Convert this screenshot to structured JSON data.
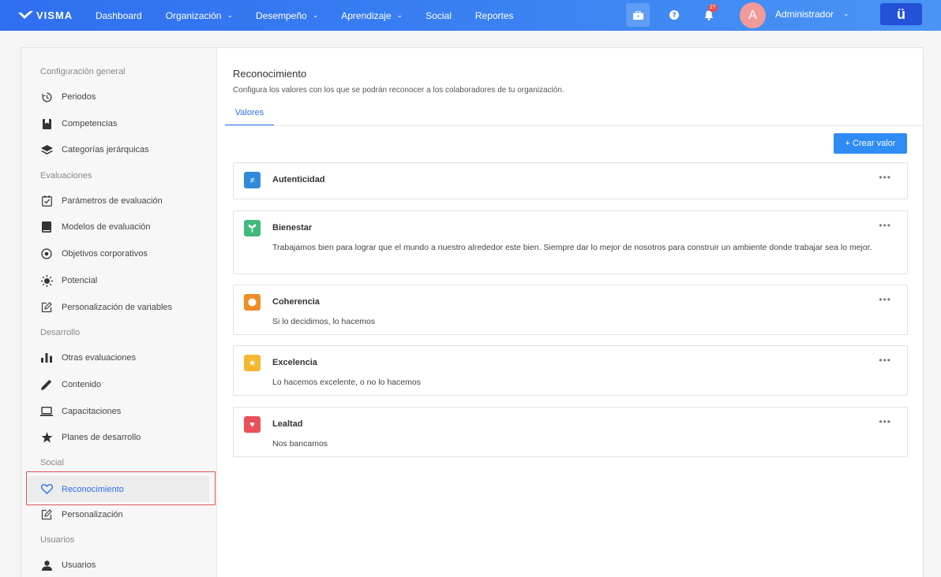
{
  "topbar": {
    "logo": "VISMA",
    "nav": [
      {
        "label": "Dashboard",
        "has_dropdown": false
      },
      {
        "label": "Organización",
        "has_dropdown": true
      },
      {
        "label": "Desempeño",
        "has_dropdown": true
      },
      {
        "label": "Aprendizaje",
        "has_dropdown": true
      },
      {
        "label": "Social",
        "has_dropdown": false
      },
      {
        "label": "Reportes",
        "has_dropdown": false
      }
    ],
    "notification_count": "27",
    "avatar_initial": "A",
    "user_name": "Administrador",
    "app_button": "ü"
  },
  "sidebar": {
    "sections": [
      {
        "title": "Configuración general",
        "items": [
          {
            "label": "Periodos",
            "icon": "history-icon"
          },
          {
            "label": "Competencias",
            "icon": "bookmark-icon"
          },
          {
            "label": "Categorías jerárquicas",
            "icon": "layers-icon"
          }
        ]
      },
      {
        "title": "Evaluaciones",
        "items": [
          {
            "label": "Parámetros de evaluación",
            "icon": "checkbox-icon"
          },
          {
            "label": "Modelos de evaluación",
            "icon": "book-icon"
          },
          {
            "label": "Objetivos corporativos",
            "icon": "target-icon"
          },
          {
            "label": "Potencial",
            "icon": "sun-icon"
          },
          {
            "label": "Personalización de variables",
            "icon": "edit-icon"
          }
        ]
      },
      {
        "title": "Desarrollo",
        "items": [
          {
            "label": "Otras evaluaciones",
            "icon": "bar-chart-icon"
          },
          {
            "label": "Contenido",
            "icon": "pencil-icon"
          },
          {
            "label": "Capacitaciones",
            "icon": "laptop-icon"
          },
          {
            "label": "Planes de desarrollo",
            "icon": "star-icon"
          }
        ]
      },
      {
        "title": "Social",
        "items": [
          {
            "label": "Reconocimiento",
            "icon": "heart-icon",
            "active": true
          },
          {
            "label": "Personalización",
            "icon": "edit-icon"
          }
        ]
      },
      {
        "title": "Usuarios",
        "items": [
          {
            "label": "Usuarios",
            "icon": "user-icon"
          }
        ]
      }
    ]
  },
  "main": {
    "title": "Reconocimiento",
    "description": "Configura los valores con los que se podrán reconocer a los colaboradores de tu organización.",
    "tab": "Valores",
    "create_button": "+ Crear valor",
    "values": [
      {
        "name": "Autenticidad",
        "description": "",
        "color": "#2f8ad8",
        "icon": "not-equal-icon",
        "glyph": "≠"
      },
      {
        "name": "Bienestar",
        "description": "Trabajamos bien para lograr que el mundo a nuestro alrededor este bien. Siempre dar lo mejor de nosotros para construir un ambiente donde trabajar sea lo mejor.",
        "color": "#3fba7a",
        "icon": "sprout-icon",
        "glyph": ""
      },
      {
        "name": "Coherencia",
        "description": "Si lo decidimos, lo hacemos",
        "color": "#f28c28",
        "icon": "circle-icon",
        "glyph": "●"
      },
      {
        "name": "Excelencia",
        "description": "Lo hacemos excelente, o no lo hacemos",
        "color": "#f5b731",
        "icon": "star-icon",
        "glyph": "★"
      },
      {
        "name": "Lealtad",
        "description": "Nos bancamos",
        "color": "#e9505a",
        "icon": "heart-icon",
        "glyph": "♥"
      }
    ],
    "more_label": "•••"
  }
}
